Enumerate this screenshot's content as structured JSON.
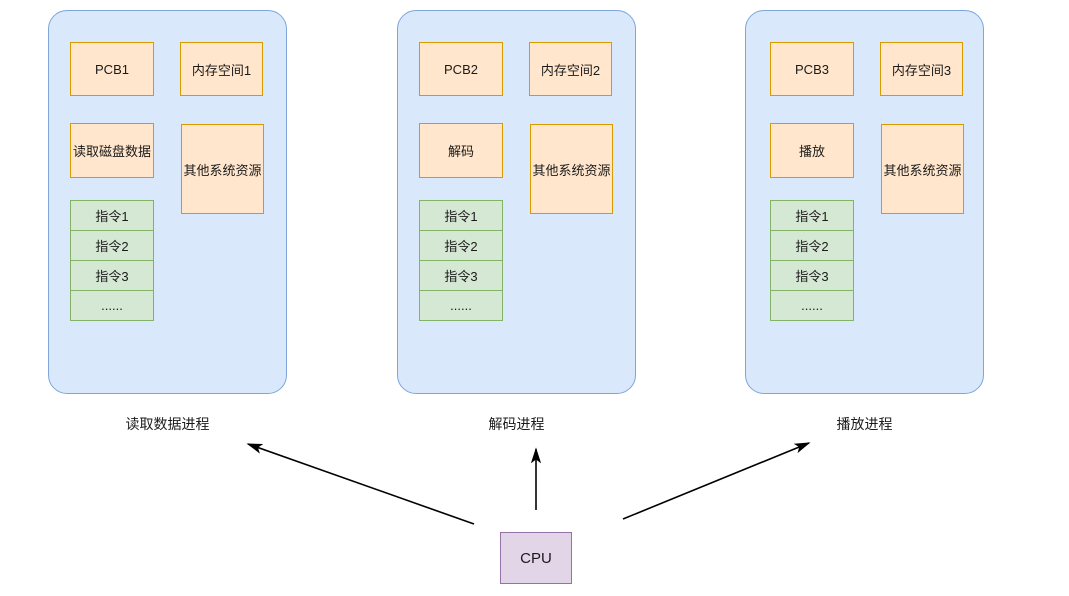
{
  "diagram": {
    "title_present": false,
    "colors": {
      "panel_fill": "#dae8fc",
      "panel_stroke": "#7ea6d9",
      "orange_fill": "#ffe6cc",
      "orange_stroke": "#d79b00",
      "green_fill": "#d5e8d4",
      "green_stroke": "#82b366",
      "purple_fill": "#e1d5e7",
      "purple_stroke": "#9673a6",
      "arrow_color": "#000000",
      "background": "#ffffff"
    },
    "processes": [
      {
        "caption": "读取数据进程",
        "pcb": "PCB1",
        "memory": "内存空间1",
        "task": "读取磁盘数据",
        "resources": "其他系统资源",
        "instructions": [
          "指令1",
          "指令2",
          "指令3",
          "......"
        ]
      },
      {
        "caption": "解码进程",
        "pcb": "PCB2",
        "memory": "内存空间2",
        "task": "解码",
        "resources": "其他系统资源",
        "instructions": [
          "指令1",
          "指令2",
          "指令3",
          "......"
        ]
      },
      {
        "caption": "播放进程",
        "pcb": "PCB3",
        "memory": "内存空间3",
        "task": "播放",
        "resources": "其他系统资源",
        "instructions": [
          "指令1",
          "指令2",
          "指令3",
          "......"
        ]
      }
    ],
    "cpu": {
      "label": "CPU"
    },
    "arrows": [
      {
        "name": "cpu-to-read-process",
        "direction": "up-left"
      },
      {
        "name": "cpu-to-decode-process",
        "direction": "up"
      },
      {
        "name": "cpu-to-play-process",
        "direction": "up-right"
      }
    ]
  }
}
